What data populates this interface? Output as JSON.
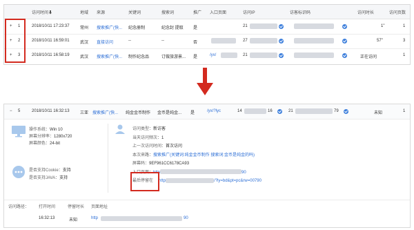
{
  "top_table": {
    "headers": [
      "访问时间",
      "地域",
      "来源",
      "关键词",
      "搜索词",
      "推广",
      "入口页面",
      "访问IP",
      "访客标识码",
      "访问时长",
      "访问页数"
    ],
    "sort_glyph": "⬇",
    "rows": [
      {
        "expand": "+",
        "num": "1",
        "time": "2018/10/11 17:23:37",
        "region": "常州",
        "source": "搜索推广(快...",
        "keyword": "纪念册制",
        "search": "纪念封 提取",
        "promo": "是",
        "ip_prefix": "21",
        "duration": "1\"",
        "pages": "1"
      },
      {
        "expand": "+",
        "num": "2",
        "time": "2018/10/11 16:59:01",
        "region": "武汉",
        "source": "直接访问",
        "keyword": "--",
        "search": "--",
        "promo": "否",
        "ip_prefix": "27",
        "duration": "57\"",
        "pages": "3"
      },
      {
        "expand": "+",
        "num": "3",
        "time": "2018/10/11 16:58:19",
        "region": "武汉",
        "source": "搜索推广(快...",
        "keyword": "制作纪念品",
        "search": "订做旅游景...",
        "promo": "是",
        "entry_prefix": "/yx/",
        "ip_prefix": "21",
        "duration": "正在访问",
        "pages": "1"
      }
    ]
  },
  "arrow_icon": "down-arrow-icon",
  "detail": {
    "row": {
      "expand": "−",
      "num": "5",
      "time": "2018/10/11 16:32:13",
      "region": "三亚",
      "source": "搜索推广(快...",
      "keyword": "纯金金币制作",
      "search": "金币是纯金...",
      "promo": "是",
      "entry_prefix": "/yx/?lyc",
      "ip_prefix": "14",
      "ip_suffix": "16",
      "id_prefix": "21",
      "id_suffix": "79",
      "duration": "未知",
      "pages": "1"
    },
    "system": [
      {
        "label": "操作系统：",
        "value": "Win 10"
      },
      {
        "label": "屏幕分辨率：",
        "value": "1280x720"
      },
      {
        "label": "屏幕颜色：",
        "value": "24-bit"
      }
    ],
    "support": [
      {
        "label": "是否支持Cookie：",
        "value": "支持"
      },
      {
        "label": "是否支持JAVA：",
        "value": "支持"
      }
    ],
    "visit": [
      {
        "label": "访问类型：",
        "value": "新访客"
      },
      {
        "label": "当天访问频次：",
        "value": "1"
      },
      {
        "label": "上一次访问时间：",
        "value": "首次访问"
      },
      {
        "label": "本次来路：",
        "value": "搜索推广(关键词:纯金金币制作 搜索词:金币是纯金的吗)"
      },
      {
        "label": "屏幕码：",
        "value": "9EF961CC6178CA93"
      }
    ],
    "entry_page": {
      "label": "入口页面：",
      "prefix": "http",
      "suffix": "90"
    },
    "last_page": {
      "label": "最后停留在",
      "prefix": "http",
      "suffix": "/?ly=bd&pt=pc&rw=00790"
    },
    "path": {
      "headers": [
        "访问路径：",
        "打开时间",
        "停留时长",
        "页面地址"
      ],
      "open_time": "16:32:13",
      "stay": "未知",
      "url_prefix": "http",
      "url_suffix": "90"
    }
  },
  "colors": {
    "accent": "#2d6fd6",
    "highlight": "#d32a1f",
    "arrow": "#d32a1f"
  }
}
